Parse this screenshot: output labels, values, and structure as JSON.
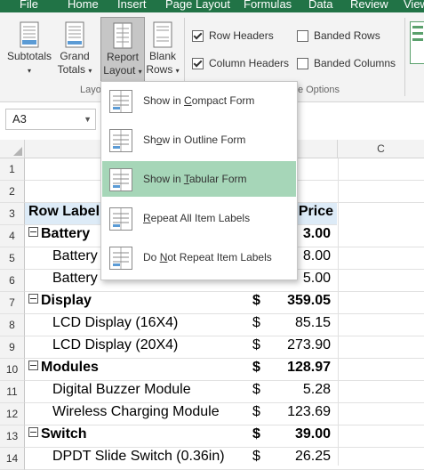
{
  "ribbon_tabs": [
    "File",
    "Home",
    "Insert",
    "Page Layout",
    "Formulas",
    "Data",
    "Review",
    "View"
  ],
  "ribbon": {
    "subtotals_label": "Subtotals",
    "grand_label_1": "Grand",
    "grand_label_2": "Totals",
    "report_label_1": "Report",
    "report_label_2": "Layout",
    "blank_label_1": "Blank",
    "blank_label_2": "Rows",
    "layout_group_label": "Layo",
    "style_options_group_label": "yle Options",
    "row_headers": "Row Headers",
    "column_headers": "Column Headers",
    "banded_rows": "Banded Rows",
    "banded_columns": "Banded Columns",
    "row_headers_checked": true,
    "column_headers_checked": true,
    "banded_rows_checked": false,
    "banded_columns_checked": false
  },
  "name_box": "A3",
  "column_headers": {
    "c": "C"
  },
  "menu": {
    "items": [
      {
        "pre": "Show in ",
        "key": "C",
        "post": "ompact Form",
        "highlighted": false
      },
      {
        "pre": "Sh",
        "key": "o",
        "post": "w in Outline Form",
        "highlighted": false
      },
      {
        "pre": "Show in ",
        "key": "T",
        "post": "abular Form",
        "highlighted": true
      },
      {
        "pre": "",
        "key": "R",
        "post": "epeat All Item Labels",
        "highlighted": false
      },
      {
        "pre": "Do ",
        "key": "N",
        "post": "ot Repeat Item Labels",
        "highlighted": false
      }
    ]
  },
  "rows": [
    {
      "num": "1",
      "a": "",
      "dollar": "",
      "value": "",
      "bold": false
    },
    {
      "num": "2",
      "a": "",
      "dollar": "",
      "value": "",
      "bold": false
    },
    {
      "num": "3",
      "a": "Row Label",
      "dollar": "",
      "value": "Price",
      "bold": true
    },
    {
      "num": "4",
      "a": "Battery",
      "dollar": "",
      "value": "3.00",
      "bold": true
    },
    {
      "num": "5",
      "a": "Battery",
      "dollar": "",
      "value": "8.00",
      "bold": false
    },
    {
      "num": "6",
      "a": "Battery",
      "dollar": "",
      "value": "5.00",
      "bold": false
    },
    {
      "num": "7",
      "a": "Display",
      "dollar": "$",
      "value": "359.05",
      "bold": true
    },
    {
      "num": "8",
      "a": "LCD Display (16X4)",
      "dollar": "$",
      "value": "85.15",
      "bold": false
    },
    {
      "num": "9",
      "a": "LCD Display (20X4)",
      "dollar": "$",
      "value": "273.90",
      "bold": false
    },
    {
      "num": "10",
      "a": "Modules",
      "dollar": "$",
      "value": "128.97",
      "bold": true
    },
    {
      "num": "11",
      "a": "Digital Buzzer Module",
      "dollar": "$",
      "value": "5.28",
      "bold": false
    },
    {
      "num": "12",
      "a": "Wireless Charging Module",
      "dollar": "$",
      "value": "123.69",
      "bold": false
    },
    {
      "num": "13",
      "a": "Switch",
      "dollar": "$",
      "value": "39.00",
      "bold": true
    },
    {
      "num": "14",
      "a": "DPDT Slide Switch (0.36in)",
      "dollar": "$",
      "value": "26.25",
      "bold": false
    }
  ],
  "colors": {
    "accent": "#217346",
    "menu_highlight": "#a6d6b8",
    "header_fill": "#ddebf7"
  }
}
